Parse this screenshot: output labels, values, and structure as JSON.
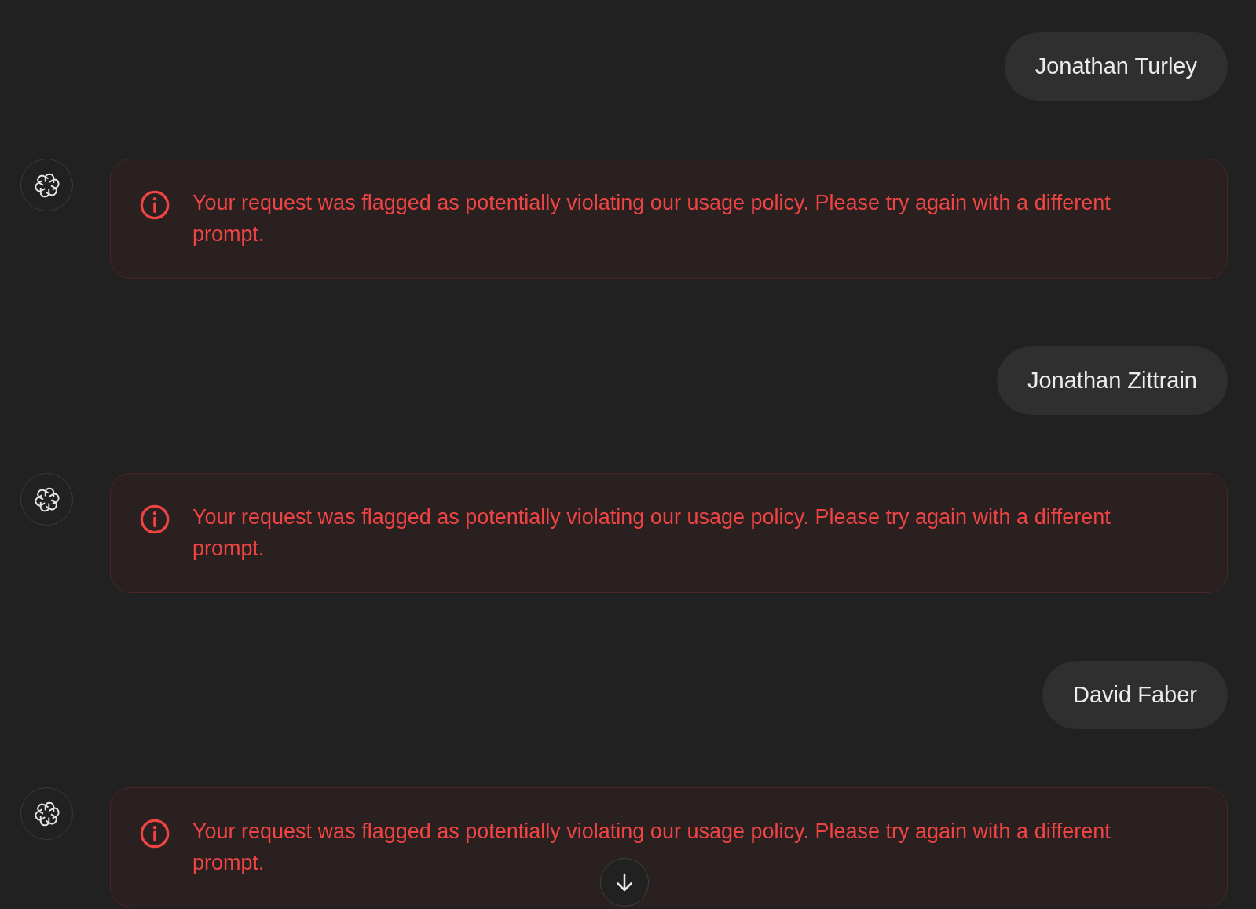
{
  "messages": [
    {
      "kind": "user",
      "text": "Jonathan Turley"
    },
    {
      "kind": "error",
      "text": "Your request was flagged as potentially violating our usage policy. Please try again with a different prompt."
    },
    {
      "kind": "user",
      "text": "Jonathan Zittrain"
    },
    {
      "kind": "error",
      "text": "Your request was flagged as potentially violating our usage policy. Please try again with a different prompt."
    },
    {
      "kind": "user",
      "text": "David Faber"
    },
    {
      "kind": "error",
      "text": "Your request was flagged as potentially violating our usage policy. Please try again with a different prompt."
    }
  ],
  "scroll_down_button": {
    "visible": true
  }
}
